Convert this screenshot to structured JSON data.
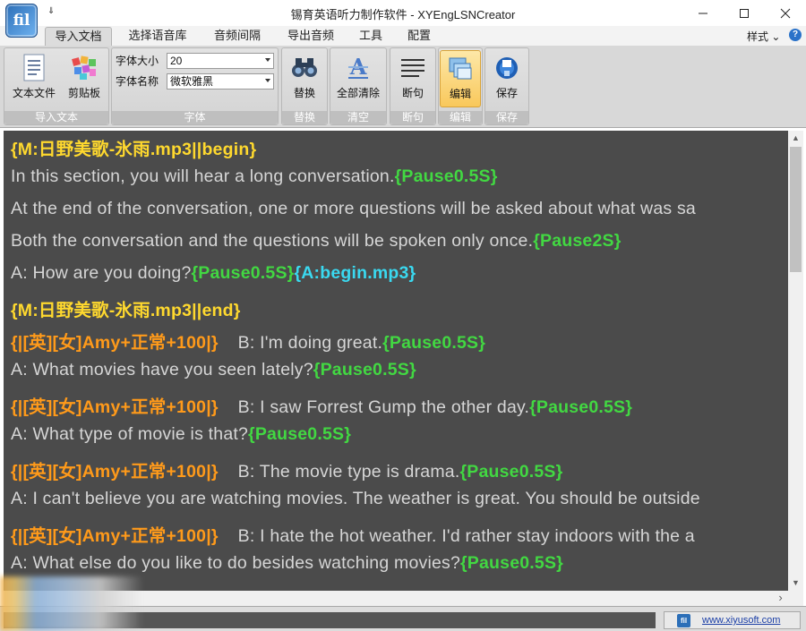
{
  "window": {
    "title": "锡育英语听力制作软件 - XYEngLSNCreator",
    "app_icon_text": "fil",
    "qat_symbol": "⇓"
  },
  "ribbon": {
    "tabs": [
      "导入文档",
      "选择语音库",
      "音频间隔",
      "导出音频",
      "工具",
      "配置"
    ],
    "active_tab": "导入文档",
    "style_label": "样式",
    "style_chevron": "⌄",
    "help_label": "?",
    "groups": {
      "import": {
        "label": "导入文本",
        "text_file": "文本文件",
        "clipboard": "剪贴板"
      },
      "font": {
        "label": "字体",
        "size_label": "字体大小",
        "size_value": "20",
        "name_label": "字体名称",
        "name_value": "微软雅黑"
      },
      "replace": {
        "label": "替换",
        "button": "替换"
      },
      "clear": {
        "label": "清空",
        "button": "全部清除"
      },
      "break": {
        "label": "断句",
        "button": "断句"
      },
      "edit": {
        "label": "编辑",
        "button": "编辑"
      },
      "save": {
        "label": "保存",
        "button": "保存"
      }
    }
  },
  "editor": {
    "lines": [
      {
        "seg": [
          {
            "t": "{M:日野美歌-氷雨.mp3||begin}",
            "c": "tag-yellow"
          }
        ]
      },
      {
        "seg": [
          {
            "t": "In this section, you will hear a long conversation.",
            "c": "plain"
          },
          {
            "t": "{Pause0.5S}",
            "c": "tag-green"
          }
        ]
      },
      {
        "seg": [
          {
            "t": "At the end of the conversation, one or more questions will be asked about what was sa",
            "c": "plain"
          }
        ]
      },
      {
        "seg": [
          {
            "t": "Both the conversation and the questions will be spoken only once.",
            "c": "plain"
          },
          {
            "t": "{Pause2S}",
            "c": "tag-green"
          }
        ]
      },
      {
        "seg": [
          {
            "t": "A: How are you doing?",
            "c": "plain"
          },
          {
            "t": "{Pause0.5S}",
            "c": "tag-green"
          },
          {
            "t": "{A:begin.mp3}",
            "c": "tag-cyan"
          }
        ]
      },
      {
        "seg": [
          {
            "t": "{M:日野美歌-氷雨.mp3||end}",
            "c": "tag-yellow"
          }
        ]
      },
      {
        "seg": [
          {
            "t": "{|[英][女]Amy+正常+100|}",
            "c": "tag-orange"
          },
          {
            "t": "B: I'm doing great.",
            "c": "plain",
            "gap": true
          },
          {
            "t": "{Pause0.5S}",
            "c": "tag-green"
          }
        ]
      },
      {
        "seg": [
          {
            "t": "A: What movies have you seen lately?",
            "c": "plain"
          },
          {
            "t": "{Pause0.5S}",
            "c": "tag-green"
          }
        ]
      },
      {
        "seg": [
          {
            "t": "{|[英][女]Amy+正常+100|}",
            "c": "tag-orange"
          },
          {
            "t": "B: I saw Forrest Gump the other day.",
            "c": "plain",
            "gap": true
          },
          {
            "t": "{Pause0.5S}",
            "c": "tag-green"
          }
        ]
      },
      {
        "seg": [
          {
            "t": "A: What type of movie is that?",
            "c": "plain"
          },
          {
            "t": "{Pause0.5S}",
            "c": "tag-green"
          }
        ]
      },
      {
        "seg": [
          {
            "t": "{|[英][女]Amy+正常+100|}",
            "c": "tag-orange"
          },
          {
            "t": "B: The movie type is drama.",
            "c": "plain",
            "gap": true
          },
          {
            "t": "{Pause0.5S}",
            "c": "tag-green"
          }
        ]
      },
      {
        "seg": [
          {
            "t": "A: I can't believe you are watching movies. The weather is great. You should be outside",
            "c": "plain"
          }
        ]
      },
      {
        "seg": [
          {
            "t": "{|[英][女]Amy+正常+100|}",
            "c": "tag-orange"
          },
          {
            "t": "B: I hate the hot weather. I'd rather stay indoors with the a",
            "c": "plain",
            "gap": true
          }
        ]
      },
      {
        "seg": [
          {
            "t": "A: What else do you like to do besides watching movies?",
            "c": "plain"
          },
          {
            "t": "{Pause0.5S}",
            "c": "tag-green"
          }
        ]
      }
    ]
  },
  "statusbar": {
    "site_link": "www.xiyusoft.com",
    "site_icon_text": "fil"
  },
  "colors": {
    "editor_bg": "#4b4b4b",
    "plain_text": "#d6d6d6",
    "tag_yellow": "#ffd92e",
    "tag_green": "#42d842",
    "tag_cyan": "#3ad9f0",
    "tag_orange": "#ff9a1a",
    "active_button": "#f9c85b"
  },
  "icons": {
    "text_file": "document-icon",
    "clipboard": "palette-icon",
    "replace": "binoculars-icon",
    "clear": "eraser-a-icon",
    "break": "lines-icon",
    "edit": "folders-icon",
    "save": "disk-icon"
  }
}
